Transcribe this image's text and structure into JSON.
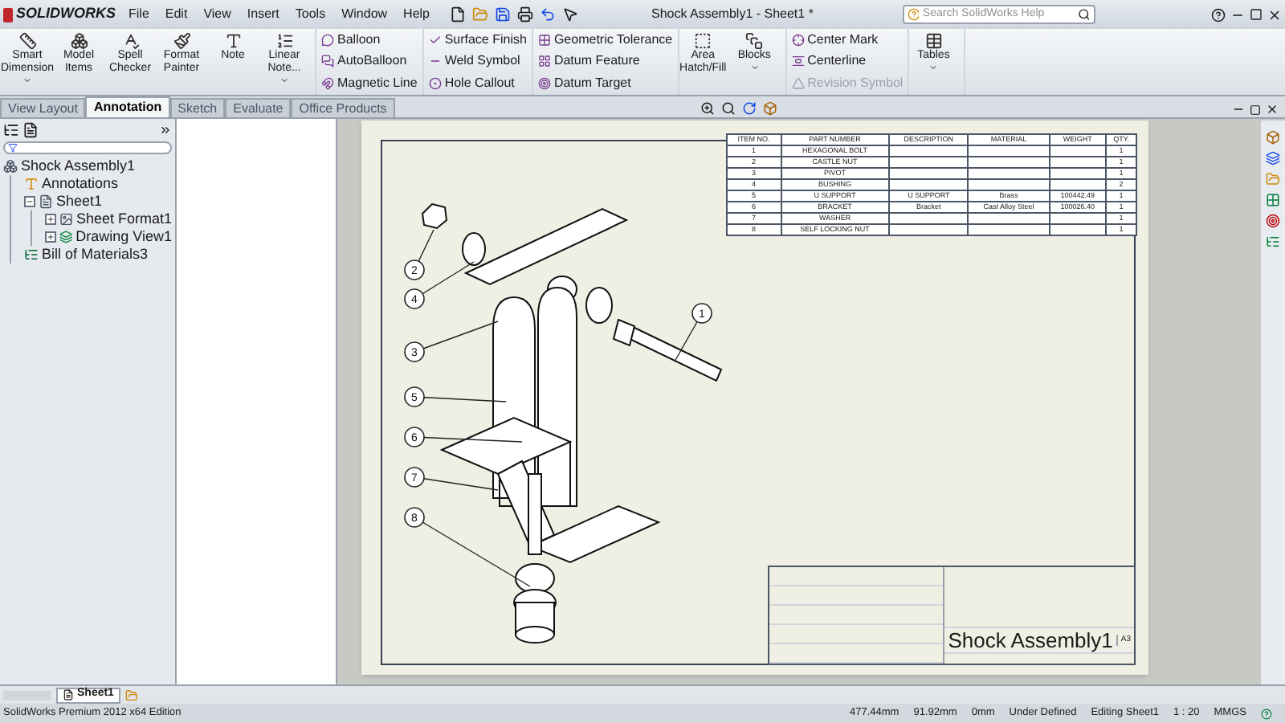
{
  "app": {
    "name": "SOLIDWORKS"
  },
  "menu": [
    "File",
    "Edit",
    "View",
    "Insert",
    "Tools",
    "Window",
    "Help"
  ],
  "window": {
    "title": "Shock Assembly1 - Sheet1 *"
  },
  "search": {
    "placeholder": "Search SolidWorks Help"
  },
  "ribbon": [
    {
      "kind": "large",
      "items": [
        {
          "label": "Smart Dimension",
          "dropdown": true,
          "disabled": false
        },
        {
          "label": "Model Items",
          "dropdown": false,
          "disabled": false
        },
        {
          "label": "Spell Checker",
          "dropdown": false,
          "disabled": false
        },
        {
          "label": "Format Painter",
          "dropdown": false,
          "disabled": false
        },
        {
          "label": "Note",
          "dropdown": false,
          "disabled": false
        },
        {
          "label": "Linear Note...",
          "dropdown": true,
          "disabled": false
        }
      ]
    },
    {
      "kind": "stack",
      "items": [
        {
          "label": "Balloon",
          "disabled": false
        },
        {
          "label": "AutoBalloon",
          "disabled": false
        },
        {
          "label": "Magnetic Line",
          "disabled": false
        }
      ]
    },
    {
      "kind": "stack",
      "items": [
        {
          "label": "Surface Finish",
          "disabled": false
        },
        {
          "label": "Weld Symbol",
          "disabled": false
        },
        {
          "label": "Hole Callout",
          "disabled": false
        }
      ]
    },
    {
      "kind": "stack",
      "items": [
        {
          "label": "Geometric Tolerance",
          "disabled": false
        },
        {
          "label": "Datum Feature",
          "disabled": false
        },
        {
          "label": "Datum Target",
          "disabled": false
        }
      ]
    },
    {
      "kind": "large",
      "items": [
        {
          "label": "Area Hatch/Fill",
          "dropdown": false,
          "disabled": false
        },
        {
          "label": "Blocks",
          "dropdown": true,
          "disabled": false
        }
      ]
    },
    {
      "kind": "stack",
      "items": [
        {
          "label": "Center Mark",
          "disabled": false
        },
        {
          "label": "Centerline",
          "disabled": false
        },
        {
          "label": "Revision Symbol",
          "disabled": true
        }
      ]
    },
    {
      "kind": "large",
      "items": [
        {
          "label": "Tables",
          "dropdown": true,
          "disabled": false
        }
      ]
    }
  ],
  "tabs": [
    {
      "label": "View Layout",
      "selected": false
    },
    {
      "label": "Annotation",
      "selected": true
    },
    {
      "label": "Sketch",
      "selected": false
    },
    {
      "label": "Evaluate",
      "selected": false
    },
    {
      "label": "Office Products",
      "selected": false
    }
  ],
  "tree": [
    {
      "label": "Shock Assembly1",
      "kind": "assembly",
      "children": [
        {
          "label": "Annotations",
          "kind": "annotations"
        },
        {
          "label": "Sheet1",
          "kind": "sheet",
          "expanded": true,
          "children": [
            {
              "label": "Sheet Format1",
              "kind": "format",
              "expanded": false
            },
            {
              "label": "Drawing View1",
              "kind": "view",
              "expanded": false
            }
          ]
        },
        {
          "label": "Bill of Materials3",
          "kind": "bom"
        }
      ]
    }
  ],
  "bom": {
    "columns": [
      "ITEM NO.",
      "PART NUMBER",
      "DESCRIPTION",
      "MATERIAL",
      "WEIGHT",
      "QTY."
    ],
    "rows": [
      [
        "1",
        "HEXAGONAL BOLT",
        "",
        "",
        "",
        "1"
      ],
      [
        "2",
        "CASTLE NUT",
        "",
        "",
        "",
        "1"
      ],
      [
        "3",
        "PIVOT",
        "",
        "",
        "",
        "1"
      ],
      [
        "4",
        "BUSHING",
        "",
        "",
        "",
        "2"
      ],
      [
        "5",
        "U SUPPORT",
        "U SUPPORT",
        "Brass",
        "100442.49",
        "1"
      ],
      [
        "6",
        "BRACKET",
        "Bracket",
        "Cast Alloy Steel",
        "100026.40",
        "1"
      ],
      [
        "7",
        "WASHER",
        "",
        "",
        "",
        "1"
      ],
      [
        "8",
        "SELF LOCKING NUT",
        "",
        "",
        "",
        "1"
      ]
    ]
  },
  "balloons": [
    "1",
    "2",
    "4",
    "3",
    "5",
    "6",
    "7",
    "8"
  ],
  "title_block": {
    "title": "Shock Assembly1",
    "size": "A3"
  },
  "sheet_tabs": [
    {
      "label": "Sheet1",
      "selected": true
    }
  ],
  "status_bar": {
    "edition": "SolidWorks Premium 2012 x64 Edition",
    "fields": [
      "477.44mm",
      "91.92mm",
      "0mm",
      "Under Defined",
      "Editing Sheet1",
      "1 : 20",
      "MMGS"
    ]
  }
}
